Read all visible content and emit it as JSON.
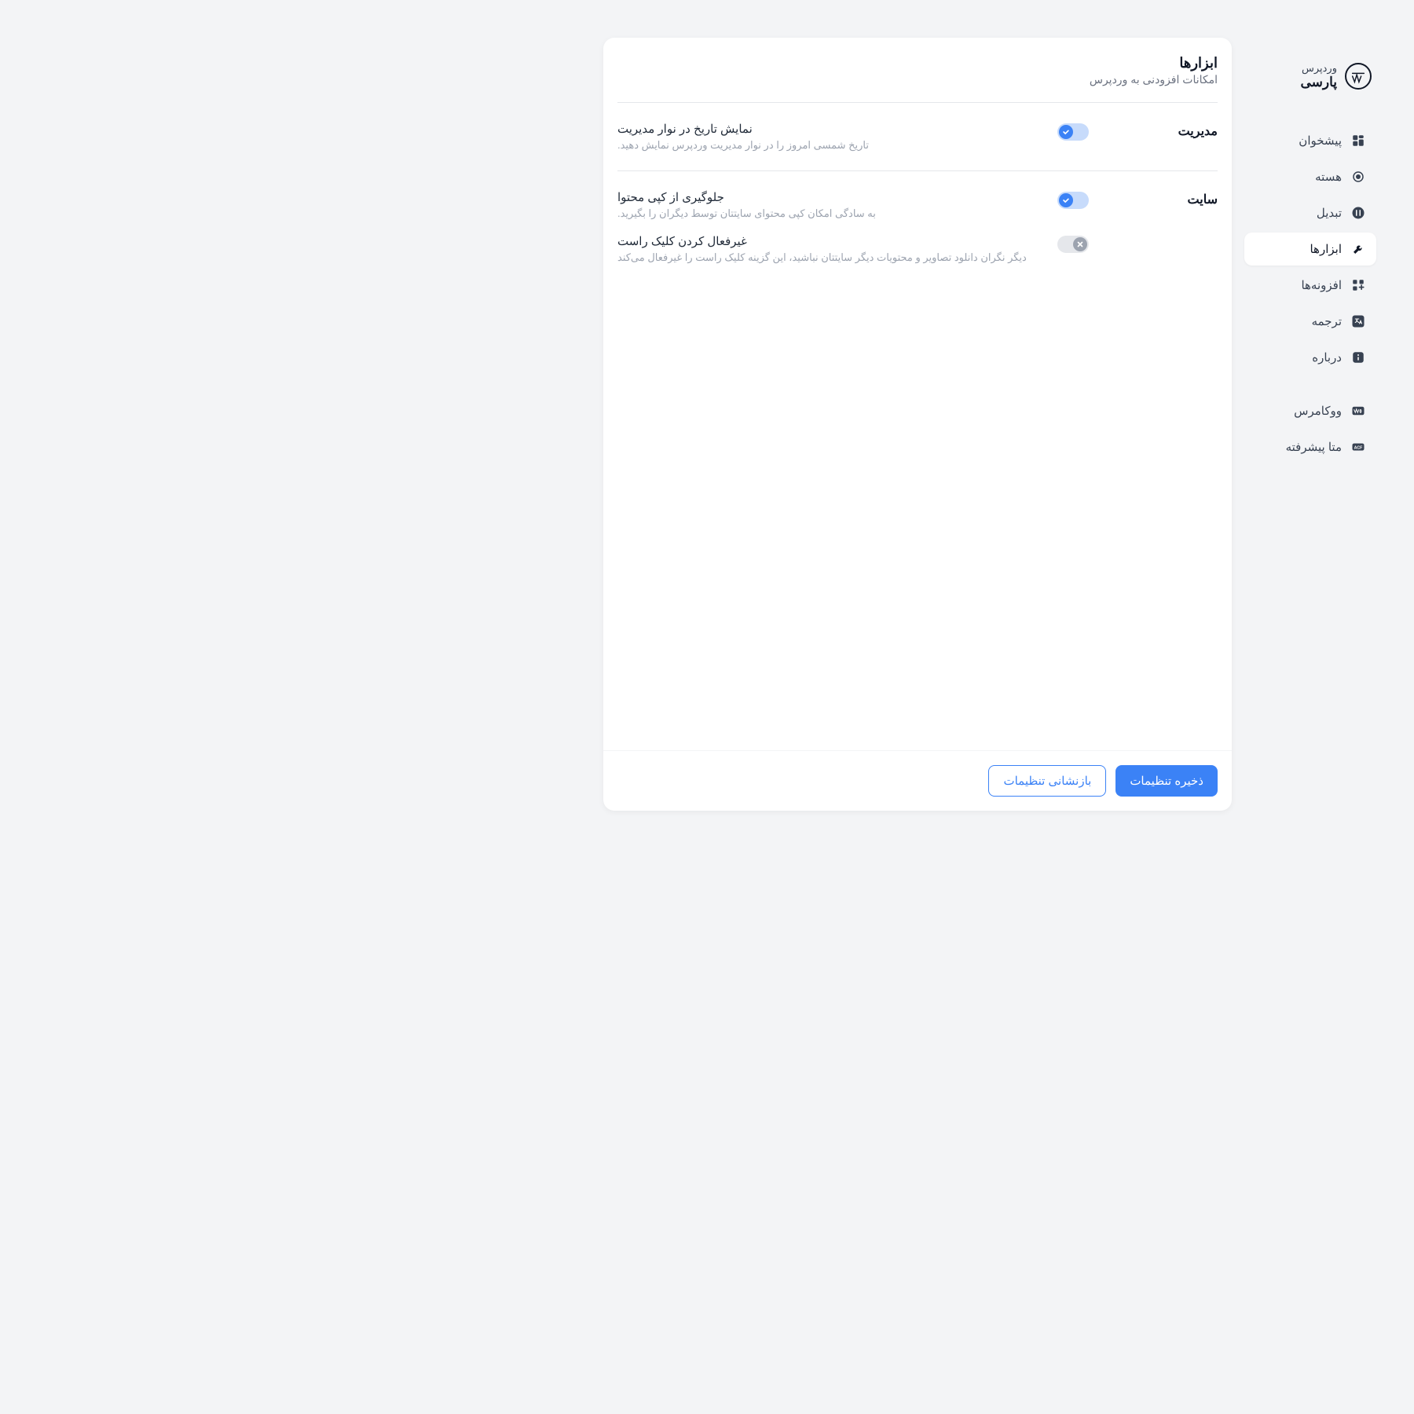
{
  "brand": {
    "top": "وردپرس",
    "bottom": "پارسی"
  },
  "nav": {
    "items": [
      {
        "label": "پیشخوان"
      },
      {
        "label": "هسته"
      },
      {
        "label": "تبدیل"
      },
      {
        "label": "ابزارها"
      },
      {
        "label": "افزونه‌ها"
      },
      {
        "label": "ترجمه"
      },
      {
        "label": "درباره"
      }
    ],
    "extra": [
      {
        "label": "ووکامرس"
      },
      {
        "label": "متا پیشرفته"
      }
    ]
  },
  "page": {
    "title": "ابزارها",
    "subtitle": "امکانات افزودنی به وردپرس"
  },
  "sections": {
    "admin": {
      "label": "مدیریت",
      "show_date": {
        "title": "نمایش تاریخ در نوار مدیریت",
        "desc": "تاریخ شمسی امروز را در نوار مدیریت وردپرس نمایش دهید."
      }
    },
    "site": {
      "label": "سایت",
      "copy_protect": {
        "title": "جلوگیری از کپی محتوا",
        "desc": "به سادگی امکان کپی محتوای سایتتان توسط دیگران را بگیرید."
      },
      "disable_rclick": {
        "title": "غیرفعال کردن کلیک راست",
        "desc": "دیگر نگران دانلود تصاویر و محتویات دیگر سایتتان نباشید، این گزینه کلیک راست را غیرفعال می‌کند"
      }
    }
  },
  "footer": {
    "save": "ذخیره تنظیمات",
    "reset": "بازنشانی تنظیمات"
  }
}
